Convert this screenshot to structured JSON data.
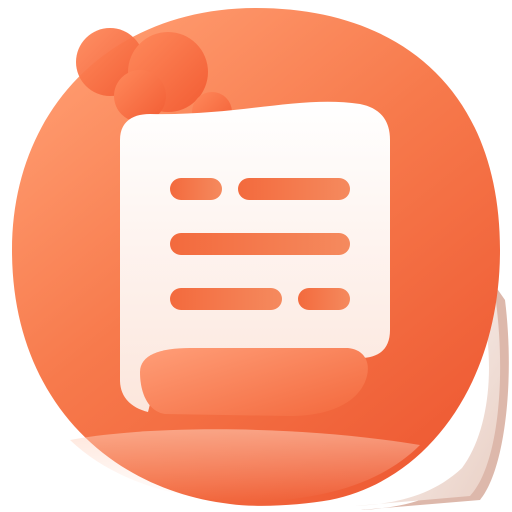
{
  "icon": {
    "name": "notes-document-app-icon",
    "colors": {
      "primary": "#F46A3F",
      "primary_light": "#FF9466",
      "primary_dark": "#E8532B",
      "paper": "#FFF2EC",
      "paper_white": "#FFFFFF",
      "page_edge": "#F7E3DA",
      "line": "#F2673A"
    },
    "document_lines": [
      {
        "row": 1,
        "segments": 2
      },
      {
        "row": 2,
        "segments": 1
      },
      {
        "row": 3,
        "segments": 2
      }
    ]
  }
}
